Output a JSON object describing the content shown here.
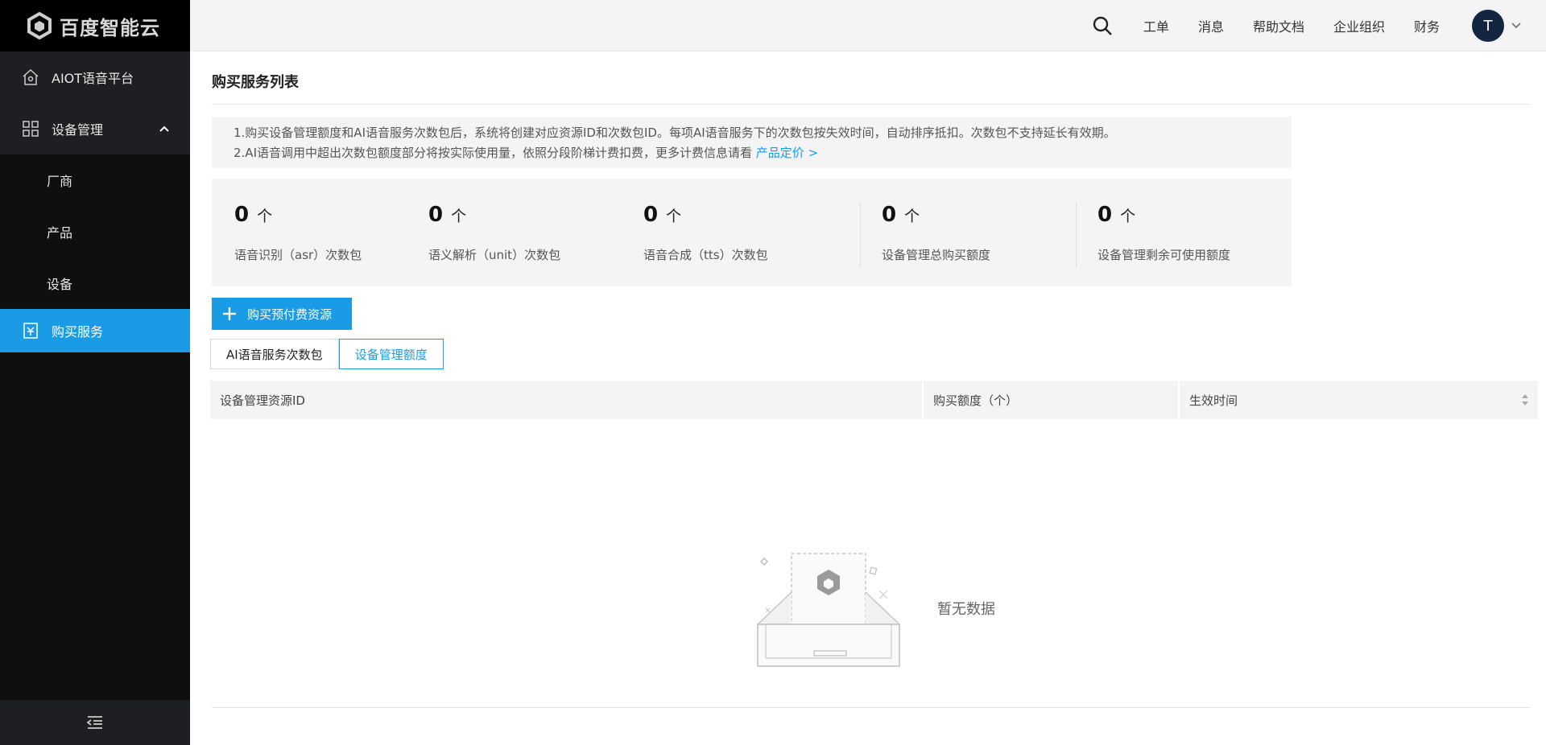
{
  "brand": {
    "logo_text": "百度智能云"
  },
  "sidebar": {
    "items": [
      {
        "label": "AIOT语音平台",
        "icon": "home-icon"
      },
      {
        "label": "设备管理",
        "icon": "grid-icon",
        "expanded": true
      },
      {
        "label": "厂商"
      },
      {
        "label": "产品"
      },
      {
        "label": "设备"
      },
      {
        "label": "购买服务",
        "icon": "receipt-icon",
        "active": true
      }
    ],
    "collapse_icon": "menu-collapse-icon"
  },
  "header": {
    "links": [
      "工单",
      "消息",
      "帮助文档",
      "企业组织",
      "财务"
    ],
    "avatar_letter": "T"
  },
  "main": {
    "title": "购买服务列表",
    "notice": {
      "line1": "1.购买设备管理额度和AI语音服务次数包后，系统将创建对应资源ID和次数包ID。每项AI语音服务下的次数包按失效时间，自动排序抵扣。次数包不支持延长有效期。",
      "line2": "2.AI语音调用中超出次数包额度部分将按实际使用量，依照分段阶梯计费扣费，更多计费信息请看",
      "link": "产品定价 >"
    },
    "stats": [
      {
        "value": "0",
        "unit": "个",
        "label": "语音识别（asr）次数包"
      },
      {
        "value": "0",
        "unit": "个",
        "label": "语义解析（unit）次数包"
      },
      {
        "value": "0",
        "unit": "个",
        "label": "语音合成（tts）次数包"
      },
      {
        "value": "0",
        "unit": "个",
        "label": "设备管理总购买额度"
      },
      {
        "value": "0",
        "unit": "个",
        "label": "设备管理剩余可使用额度"
      }
    ],
    "buy_button": "购买预付费资源",
    "tabs": [
      {
        "label": "AI语音服务次数包",
        "active": false
      },
      {
        "label": "设备管理额度",
        "active": true
      }
    ],
    "table": {
      "columns": [
        "设备管理资源ID",
        "购买额度（个）",
        "生效时间"
      ]
    },
    "empty_text": "暂无数据"
  },
  "colors": {
    "accent": "#1a9be6",
    "sidebar_bg": "#0f0f10",
    "avatar_bg": "#14263f"
  }
}
